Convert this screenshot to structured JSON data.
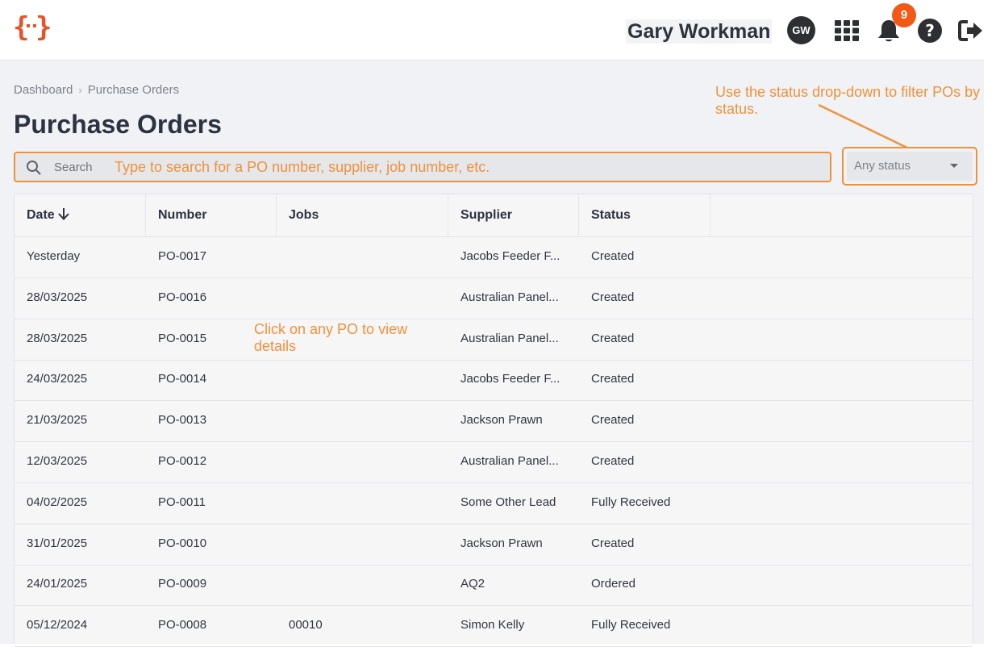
{
  "header": {
    "user_name": "Gary Workman",
    "avatar_initials": "GW",
    "notification_count": "9"
  },
  "breadcrumb": {
    "items": [
      "Dashboard",
      "Purchase Orders"
    ]
  },
  "page": {
    "title": "Purchase Orders"
  },
  "search": {
    "placeholder": "Search"
  },
  "filter": {
    "status_value": "Any status"
  },
  "tips": {
    "status": "Use the status drop-down to filter POs by status.",
    "search": "Type to search for a PO number, supplier, job number, etc.",
    "click": "Click on any PO to view details"
  },
  "table": {
    "columns": [
      "Date",
      "Number",
      "Jobs",
      "Supplier",
      "Status"
    ],
    "rows": [
      {
        "date": "Yesterday",
        "number": "PO-0017",
        "jobs": "",
        "supplier": "Jacobs Feeder F...",
        "status": "Created"
      },
      {
        "date": "28/03/2025",
        "number": "PO-0016",
        "jobs": "",
        "supplier": "Australian Panel...",
        "status": "Created"
      },
      {
        "date": "28/03/2025",
        "number": "PO-0015",
        "jobs": "",
        "supplier": "Australian Panel...",
        "status": "Created"
      },
      {
        "date": "24/03/2025",
        "number": "PO-0014",
        "jobs": "",
        "supplier": "Jacobs Feeder F...",
        "status": "Created"
      },
      {
        "date": "21/03/2025",
        "number": "PO-0013",
        "jobs": "",
        "supplier": "Jackson Prawn",
        "status": "Created"
      },
      {
        "date": "12/03/2025",
        "number": "PO-0012",
        "jobs": "",
        "supplier": "Australian Panel...",
        "status": "Created"
      },
      {
        "date": "04/02/2025",
        "number": "PO-0011",
        "jobs": "",
        "supplier": "Some Other Lead",
        "status": "Fully Received"
      },
      {
        "date": "31/01/2025",
        "number": "PO-0010",
        "jobs": "",
        "supplier": "Jackson Prawn",
        "status": "Created"
      },
      {
        "date": "24/01/2025",
        "number": "PO-0009",
        "jobs": "",
        "supplier": "AQ2",
        "status": "Ordered"
      },
      {
        "date": "05/12/2024",
        "number": "PO-0008",
        "jobs": "00010",
        "supplier": "Simon Kelly",
        "status": "Fully Received"
      }
    ]
  },
  "colors": {
    "accent": "#f0913a",
    "badge": "#f05a16",
    "logo": "#e8522a"
  }
}
